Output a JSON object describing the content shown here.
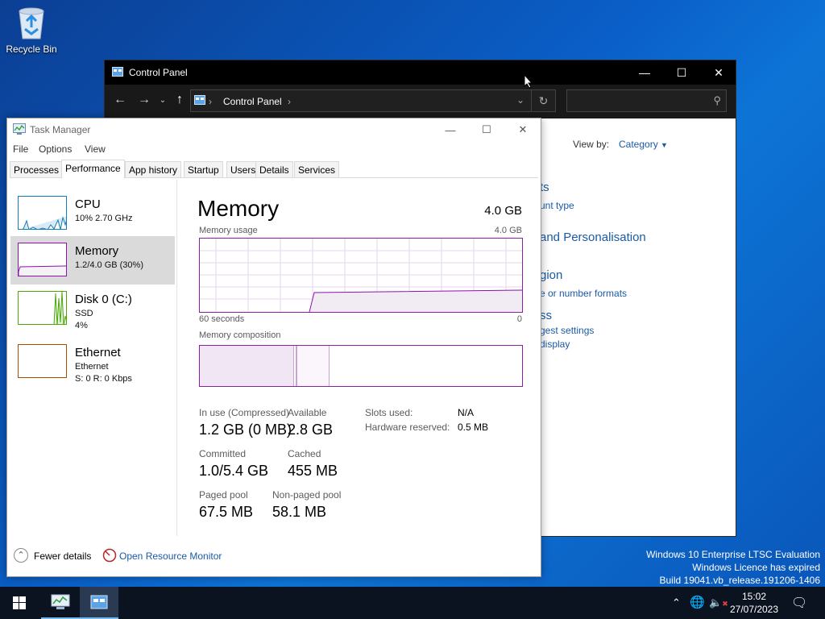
{
  "desktop": {
    "recycle_bin_label": "Recycle Bin",
    "watermark": {
      "line1": "Windows 10 Enterprise LTSC Evaluation",
      "line2": "Windows Licence has expired",
      "line3": "Build 19041.vb_release.191206-1406"
    }
  },
  "control_panel": {
    "title": "Control Panel",
    "path": "Control Panel",
    "view_by_label": "View by:",
    "view_by_value": "Category",
    "fragments": [
      "ts",
      "unt type",
      "and Personalisation",
      "gion",
      "e or number formats",
      "ss",
      "gest settings",
      "display"
    ],
    "title_color": "#000000",
    "link_color": "#1a5aa6"
  },
  "task_manager": {
    "title": "Task Manager",
    "menu": [
      "File",
      "Options",
      "View"
    ],
    "tabs": [
      "Processes",
      "Performance",
      "App history",
      "Startup",
      "Users",
      "Details",
      "Services"
    ],
    "active_tab": "Performance",
    "sidebar": [
      {
        "name": "CPU",
        "line1": "10%  2.70 GHz",
        "line2": "",
        "color": "#117dbb"
      },
      {
        "name": "Memory",
        "line1": "1.2/4.0 GB (30%)",
        "line2": "",
        "color": "#8b12ae",
        "selected": true
      },
      {
        "name": "Disk 0 (C:)",
        "line1": "SSD",
        "line2": "4%",
        "color": "#4da60c"
      },
      {
        "name": "Ethernet",
        "line1": "Ethernet",
        "line2": "S: 0  R: 0 Kbps",
        "color": "#a74f01"
      }
    ],
    "memory": {
      "heading": "Memory",
      "total": "4.0 GB",
      "usage_label": "Memory usage",
      "usage_max": "4.0 GB",
      "time_label": "60 seconds",
      "time_min": "0",
      "composition_label": "Memory composition",
      "stats": {
        "in_use_label": "In use (Compressed)",
        "in_use_value": "1.2 GB (0 MB)",
        "available_label": "Available",
        "available_value": "2.8 GB",
        "committed_label": "Committed",
        "committed_value": "1.0/5.4 GB",
        "cached_label": "Cached",
        "cached_value": "455 MB",
        "paged_label": "Paged pool",
        "paged_value": "67.5 MB",
        "nonpaged_label": "Non-paged pool",
        "nonpaged_value": "58.1 MB",
        "slots_label": "Slots used:",
        "slots_value": "N/A",
        "hw_label": "Hardware reserved:",
        "hw_value": "0.5 MB"
      },
      "usage_fraction": 0.3,
      "accent": "#8b12ae"
    },
    "footer": {
      "fewer_details": "Fewer details",
      "open_resource_monitor": "Open Resource Monitor"
    }
  },
  "taskbar": {
    "time": "15:02",
    "date": "27/07/2023"
  }
}
